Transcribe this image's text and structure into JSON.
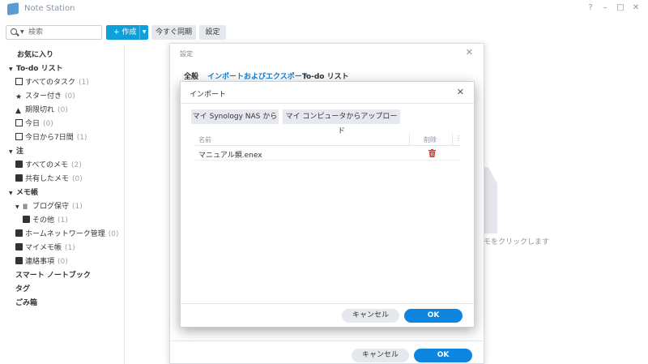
{
  "app": {
    "title": "Note Station"
  },
  "window_controls": {
    "help": "?",
    "minimize": "–",
    "maximize": "□",
    "close": "✕"
  },
  "toolbar": {
    "search_placeholder": "検索",
    "create_label": "+ 作成",
    "sync_label": "今すぐ同期",
    "settings_label": "設定"
  },
  "sidebar": {
    "favorites": "お気に入り",
    "todo_section": "To-do リスト",
    "todo_items": [
      {
        "label": "すべてのタスク",
        "count": "(1)"
      },
      {
        "label": "スター付き",
        "count": "(0)"
      },
      {
        "label": "期限切れ",
        "count": "(0)"
      },
      {
        "label": "今日",
        "count": "(0)"
      },
      {
        "label": "今日から7日間",
        "count": "(1)"
      }
    ],
    "notes_section": "注",
    "notes_items": [
      {
        "label": "すべてのメモ",
        "count": "(2)"
      },
      {
        "label": "共有したメモ",
        "count": "(0)"
      }
    ],
    "notebook_section": "メモ帳",
    "notebook_stack": {
      "label": "ブログ保守",
      "count": "(1)"
    },
    "notebook_stack_child": {
      "label": "その他",
      "count": "(1)"
    },
    "notebooks": [
      {
        "label": "ホームネットワーク管理",
        "count": "(0)"
      },
      {
        "label": "マイメモ帳",
        "count": "(1)"
      },
      {
        "label": "連絡事項",
        "count": "(0)"
      }
    ],
    "smart_notebook": "スマート ノートブック",
    "tags": "タグ",
    "trash": "ごみ箱"
  },
  "background": {
    "hint": "モをクリックします"
  },
  "settings_dialog": {
    "title": "設定",
    "tabs": [
      "全般",
      "インポートおよびエクスポート",
      "To-do リスト"
    ],
    "active_tab": "インポートおよびエクスポート",
    "cancel": "キャンセル",
    "ok": "OK"
  },
  "import_dialog": {
    "title": "インポート",
    "source_nas": "マイ Synology NAS から",
    "source_pc": "マイ コンピュータからアップロード",
    "col_name": "名前",
    "col_delete": "削除",
    "col_more": "⋮",
    "files": [
      {
        "name": "マニュアル類.enex"
      }
    ],
    "cancel": "キャンセル",
    "ok": "OK"
  },
  "colors": {
    "accent": "#0ea0db",
    "ok_button": "#0e86e0",
    "active_tab": "#0e7fd4",
    "trash_icon": "#e0362c"
  }
}
